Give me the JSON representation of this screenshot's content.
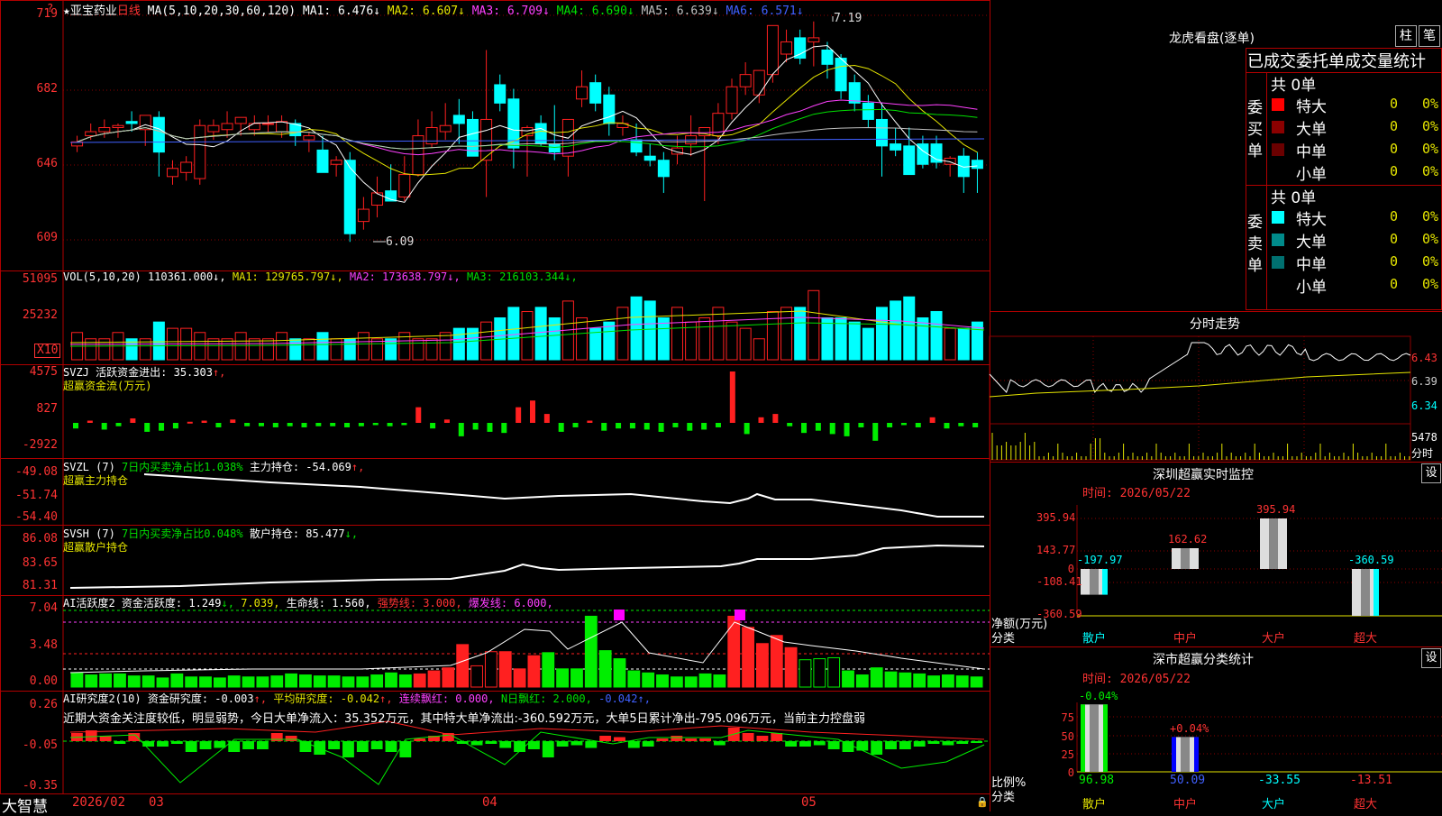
{
  "colors": {
    "up": "#ff2020",
    "down": "#00ffff",
    "vol_up": "#ff2020",
    "vol_down": "#00ffff",
    "ma1": "#ffffff",
    "ma2": "#e5e500",
    "ma3": "#ff40ff",
    "ma4": "#00e000",
    "ma5": "#c0c0c0",
    "ma6": "#4060ff",
    "grid": "#8b0000",
    "frame": "#b00000",
    "green_bar": "#00ee00",
    "red_bar": "#ff2020"
  },
  "main": {
    "stock_name": "★亚宝药业",
    "period": "日线",
    "ma_header": "MA(5,10,20,30,60,120)",
    "ma_values": [
      {
        "label": "MA1:",
        "value": "6.476↓",
        "color": "#ffffff"
      },
      {
        "label": "MA2:",
        "value": "6.607↓",
        "color": "#e5e500"
      },
      {
        "label": "MA3:",
        "value": "6.709↓",
        "color": "#ff40ff"
      },
      {
        "label": "MA4:",
        "value": "6.690↓",
        "color": "#00e000"
      },
      {
        "label": "MA5:",
        "value": "6.639↓",
        "color": "#c0c0c0"
      },
      {
        "label": "MA6:",
        "value": "6.571↓",
        "color": "#4060ff"
      }
    ],
    "y_labels": [
      "719",
      "682",
      "646",
      "609"
    ],
    "high_label": "7.19",
    "low_label": "6.09",
    "corner_mark": "?"
  },
  "vol": {
    "header_name": "VOL(5,10,20)",
    "values": [
      {
        "text": "110361.000↓",
        "color": "#ffffff"
      },
      {
        "text": "MA1: 129765.797↓",
        "color": "#e5e500"
      },
      {
        "text": "MA2: 173638.797↓",
        "color": "#ff40ff"
      },
      {
        "text": "MA3: 216103.344↓",
        "color": "#00e000"
      }
    ],
    "y_labels": [
      "51095",
      "25232"
    ],
    "unit": "X10"
  },
  "svzj": {
    "line1": {
      "name": "SVZJ",
      "label": "活跃资金进出: 35.303",
      "arrow": "↑,"
    },
    "line2": "超赢资金流(万元)",
    "y_labels": [
      "4575",
      "827",
      "-2922"
    ]
  },
  "svzl": {
    "name": "SVZL (7)",
    "desc": "7日内买卖净占比1.038%",
    "holding": "主力持仓: -54.069",
    "arrow": "↑,",
    "line2": "超赢主力持仓",
    "y_labels": [
      "-49.08",
      "-51.74",
      "-54.40"
    ]
  },
  "svsh": {
    "name": "SVSH (7)",
    "desc": "7日内买卖净占比0.048%",
    "holding": "散户持仓: 85.477",
    "arrow": "↓,",
    "line2": "超赢散户持仓",
    "y_labels": [
      "86.08",
      "83.65",
      "81.31"
    ]
  },
  "ai1": {
    "name": "AI活跃度2",
    "p1": "资金活跃度: 1.249",
    "p1a": "↓,",
    "p2": "7.039,",
    "p3": "生命线: 1.560,",
    "p4": "强势线: 3.000,",
    "p5": "爆发线: 6.000,",
    "y_labels": [
      "7.04",
      "3.48",
      "0.00"
    ]
  },
  "ai2": {
    "name": "AI研究度2(10)",
    "p1": "资金研究度: -0.003",
    "p1a": "↑,",
    "p2": "平均研究度: -0.042",
    "p2a": "↑,",
    "p3": "连续飘红: 0.000,",
    "p4": "N日飘红: 2.000,",
    "p5": "-0.042↑,",
    "comment": "近期大资金关注度较低，明显弱势，今日大单净流入：35.352万元，其中特大单净流出:-360.592万元，大单5日累计净出-795.096万元，当前主力控盘弱",
    "y_labels": [
      "0.26",
      "-0.05",
      "-0.35"
    ]
  },
  "bottom": {
    "brand": "大智慧",
    "year": "2026/02",
    "months": [
      "03",
      "04",
      "05"
    ]
  },
  "right": {
    "lhb_title": "龙虎看盘(逐单)",
    "btn_zhu": "柱",
    "btn_bi": "笔",
    "tabs": "已成交委托单成交量统计",
    "buy": {
      "side_label": [
        "委",
        "买",
        "单"
      ],
      "total": "共 0单",
      "rows": [
        {
          "name": "特大",
          "val": "0",
          "pct": "0%",
          "color": "#ff0000"
        },
        {
          "name": "大单",
          "val": "0",
          "pct": "0%",
          "color": "#8b0000"
        },
        {
          "name": "中单",
          "val": "0",
          "pct": "0%",
          "color": "#6b0000"
        },
        {
          "name": "小单",
          "val": "0",
          "pct": "0%",
          "color": ""
        }
      ]
    },
    "sell": {
      "side_label": [
        "委",
        "卖",
        "单"
      ],
      "total": "共 0单",
      "rows": [
        {
          "name": "特大",
          "val": "0",
          "pct": "0%",
          "color": "#00ffff"
        },
        {
          "name": "大单",
          "val": "0",
          "pct": "0%",
          "color": "#008b8b"
        },
        {
          "name": "中单",
          "val": "0",
          "pct": "0%",
          "color": "#007070"
        },
        {
          "name": "小单",
          "val": "0",
          "pct": "0%",
          "color": ""
        }
      ]
    },
    "intraday": {
      "title": "分时走势",
      "y_labels": [
        "6.43",
        "6.39",
        "6.34"
      ],
      "vol_label": "5478",
      "fenshi": "分时"
    },
    "sz_monitor": {
      "title": "深圳超赢实时监控",
      "btn": "设",
      "time": "时间: 2026/05/22",
      "y_labels": [
        "395.94",
        "143.77",
        "0",
        "-108.41",
        "-360.59"
      ],
      "bars": [
        {
          "cat": "散户",
          "value": -197.97,
          "label": "-197.97"
        },
        {
          "cat": "中户",
          "value": 162.62,
          "label": "162.62"
        },
        {
          "cat": "大户",
          "value": 395.94,
          "label": "395.94"
        },
        {
          "cat": "超大",
          "value": -360.59,
          "label": "-360.59"
        }
      ],
      "axis_label": "净额(万元)",
      "cat_label": "分类"
    },
    "sz_class": {
      "title": "深市超赢分类统计",
      "btn": "设",
      "time": "时间: 2026/05/22",
      "y_labels": [
        "75",
        "50",
        "25",
        "0"
      ],
      "bars": [
        {
          "cat": "散户",
          "value": 96.98,
          "change": "-0.04%"
        },
        {
          "cat": "中户",
          "value": 50.09,
          "change": "+0.04%"
        },
        {
          "cat": "大户",
          "value": -33.55,
          "change": ""
        },
        {
          "cat": "超大",
          "value": -13.51,
          "change": ""
        }
      ],
      "axis_label": "比例%",
      "cat_label": "分类"
    }
  }
}
